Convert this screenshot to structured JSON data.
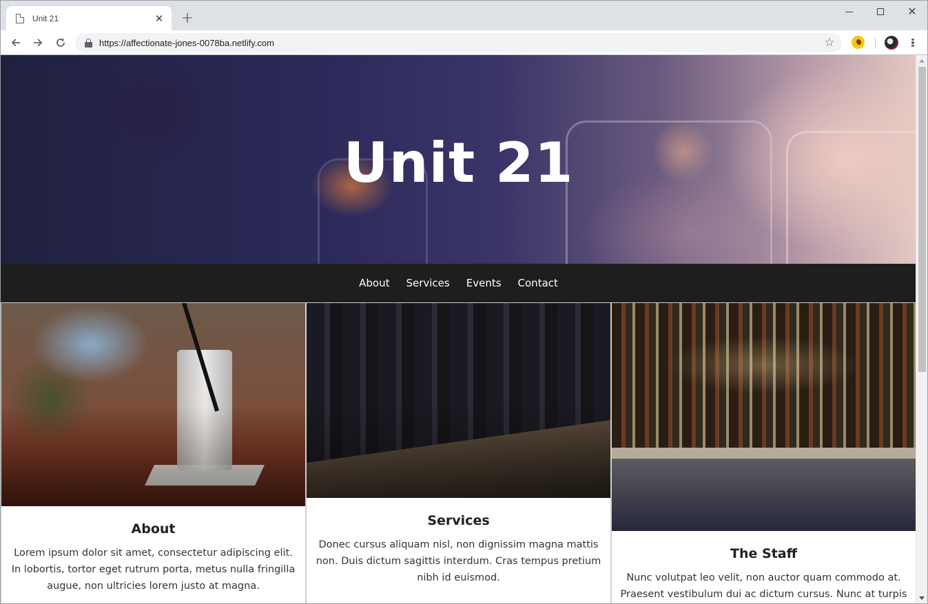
{
  "browser": {
    "tab_title": "Unit 21",
    "tab_close": "✕",
    "new_tab": "+",
    "url": "https://affectionate-jones-0078ba.netlify.com",
    "star_glyph": "☆",
    "window_close": "✕",
    "nav_icons": [
      "back-arrow-icon",
      "forward-arrow-icon",
      "reload-icon"
    ]
  },
  "hero": {
    "title": "Unit 21"
  },
  "nav": {
    "items": [
      "About",
      "Services",
      "Events",
      "Contact"
    ]
  },
  "cards": [
    {
      "heading": "About",
      "text": "Lorem ipsum dolor sit amet, consectetur adipiscing elit. In lobortis, tortor eget rutrum porta, metus nulla fringilla augue, non ultricies lorem justo at magna."
    },
    {
      "heading": "Services",
      "text": "Donec cursus aliquam nisl, non dignissim magna mattis non. Duis dictum sagittis interdum. Cras tempus pretium nibh id euismod."
    },
    {
      "heading": "The Staff",
      "text": "Nunc volutpat leo velit, non auctor quam commodo at. Praesent vestibulum dui ac dictum cursus. Nunc at turpis"
    }
  ],
  "colors": {
    "nav_background": "#1e1e1e",
    "hero_text": "#ffffff"
  }
}
